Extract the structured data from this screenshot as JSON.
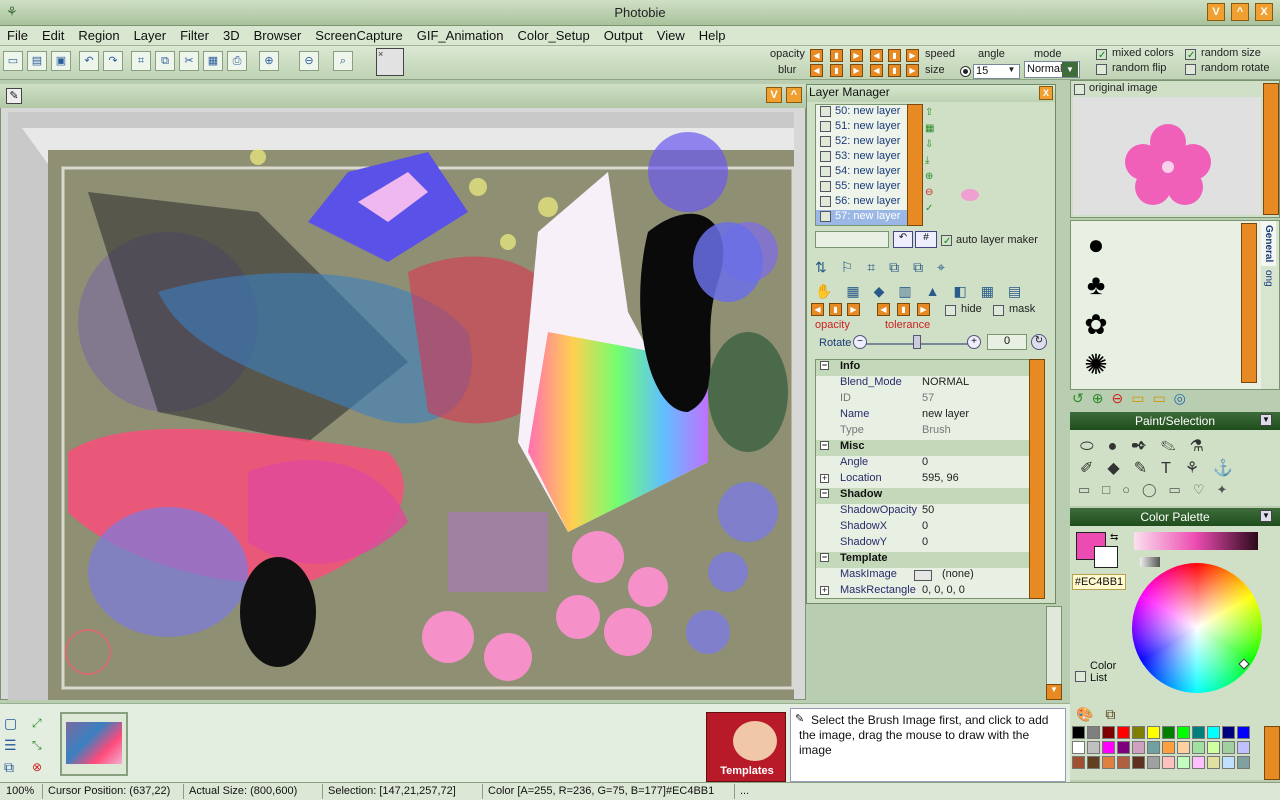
{
  "app": {
    "title": "Photobie",
    "icon": "palm-tree-icon"
  },
  "window_buttons": [
    "V",
    "^",
    "X"
  ],
  "menu": [
    "File",
    "Edit",
    "Region",
    "Layer",
    "Filter",
    "3D",
    "Browser",
    "ScreenCapture",
    "GIF_Animation",
    "Color_Setup",
    "Output",
    "View",
    "Help"
  ],
  "toolbar": {
    "opacity_label": "opacity",
    "blur_label": "blur",
    "speed_label": "speed",
    "size_label": "size",
    "angle_label": "angle",
    "angle_value": "15",
    "mode_label": "mode",
    "mode_value": "Normal",
    "mixed_colors": "mixed colors",
    "random_size": "random size",
    "random_flip": "random flip",
    "random_rotate": "random rotate",
    "mixed_colors_checked": true,
    "random_size_checked": true,
    "random_flip_checked": false,
    "random_rotate_checked": false
  },
  "layer_manager": {
    "title": "Layer Manager",
    "layers": [
      "50: new layer",
      "51: new layer",
      "52: new layer",
      "53: new layer",
      "54: new layer",
      "55: new layer",
      "56: new layer",
      "57: new layer"
    ],
    "selected_index": 7,
    "auto_layer_maker": "auto layer maker",
    "hide": "hide",
    "mask": "mask",
    "opacity": "opacity",
    "tolerance": "tolerance",
    "rotate_label": "Rotate",
    "rotate_value": "0",
    "properties": [
      {
        "section": "Info"
      },
      {
        "k": "Blend_Mode",
        "v": "NORMAL"
      },
      {
        "k": "ID",
        "v": "57",
        "dim": true
      },
      {
        "k": "Name",
        "v": "new layer"
      },
      {
        "k": "Type",
        "v": "Brush",
        "dim": true
      },
      {
        "section": "Misc"
      },
      {
        "k": "Angle",
        "v": "0"
      },
      {
        "k": "Location",
        "v": "595, 96",
        "expand": true
      },
      {
        "section": "Shadow"
      },
      {
        "k": "ShadowOpacity",
        "v": "50"
      },
      {
        "k": "ShadowX",
        "v": "0"
      },
      {
        "k": "ShadowY",
        "v": "0"
      },
      {
        "section": "Template"
      },
      {
        "k": "MaskImage",
        "v": "(none)"
      },
      {
        "k": "MaskRectangle",
        "v": "0, 0, 0, 0",
        "expand": true
      }
    ]
  },
  "right_panel": {
    "original_image": "original image",
    "tabs": [
      "General",
      "ong"
    ],
    "paint_selection": "Paint/Selection",
    "color_palette": "Color Palette",
    "color_hex": "#EC4BB1",
    "color_list": "Color List",
    "primary_color": "#EC4BB1"
  },
  "bottom": {
    "templates_label": "Templates",
    "hint": "Select the Brush Image first, and click to add the image, drag the mouse to draw with the image"
  },
  "status": {
    "zoom": "100%",
    "cursor": "Cursor Position: (637,22)",
    "actual_size": "Actual Size: (800,600)",
    "selection": "Selection: [147,21,257,72]",
    "color": "Color [A=255, R=236, G=75, B=177]#EC4BB1",
    "more": "..."
  },
  "palette_colors": [
    "#000000",
    "#7f7f7f",
    "#7f0000",
    "#ff0000",
    "#7f7f00",
    "#ffff00",
    "#007f00",
    "#00ff00",
    "#007f7f",
    "#00ffff",
    "#00007f",
    "#0000ff",
    "#ffffff",
    "#c0c0c0",
    "#ff00ff",
    "#7f007f",
    "#d0a0c0",
    "#70a0a0",
    "#ffa040",
    "#ffd0a0",
    "#a0e0a0",
    "#d0ffa0",
    "#a0d0a0",
    "#c0c0ff",
    "#a05030",
    "#604020",
    "#e08040",
    "#b06040",
    "#603020",
    "#a0a0a0",
    "#ffc0c0",
    "#c0ffc0",
    "#ffc0ff",
    "#e0e0a0",
    "#c0e0ff",
    "#80a0a0"
  ]
}
